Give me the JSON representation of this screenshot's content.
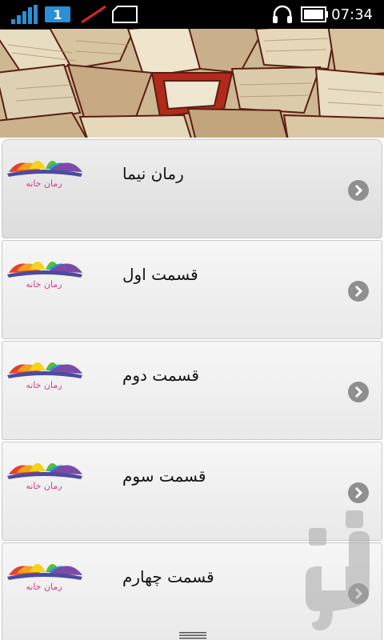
{
  "status_bar": {
    "sim_badge": "1",
    "time": "07:34",
    "icons": [
      "signal-icon",
      "sim-badge",
      "no-data-icon",
      "sim-card-icon",
      "headset-icon",
      "battery-icon"
    ]
  },
  "header": {
    "image": "books-banner"
  },
  "list": {
    "items": [
      {
        "label": "رمان نیما",
        "logo_text": "رمان خانه"
      },
      {
        "label": "قسمت اول",
        "logo_text": "رمان خانه"
      },
      {
        "label": "قسمت دوم",
        "logo_text": "رمان خانه"
      },
      {
        "label": "قسمت سوم",
        "logo_text": "رمان خانه"
      },
      {
        "label": "قسمت چهارم",
        "logo_text": "رمان خانه"
      }
    ]
  },
  "colors": {
    "status_bar_bg": "#000000",
    "badge": "#2b8fd6",
    "row_bg": "#ececec",
    "chevron": "#8f8f8f"
  }
}
